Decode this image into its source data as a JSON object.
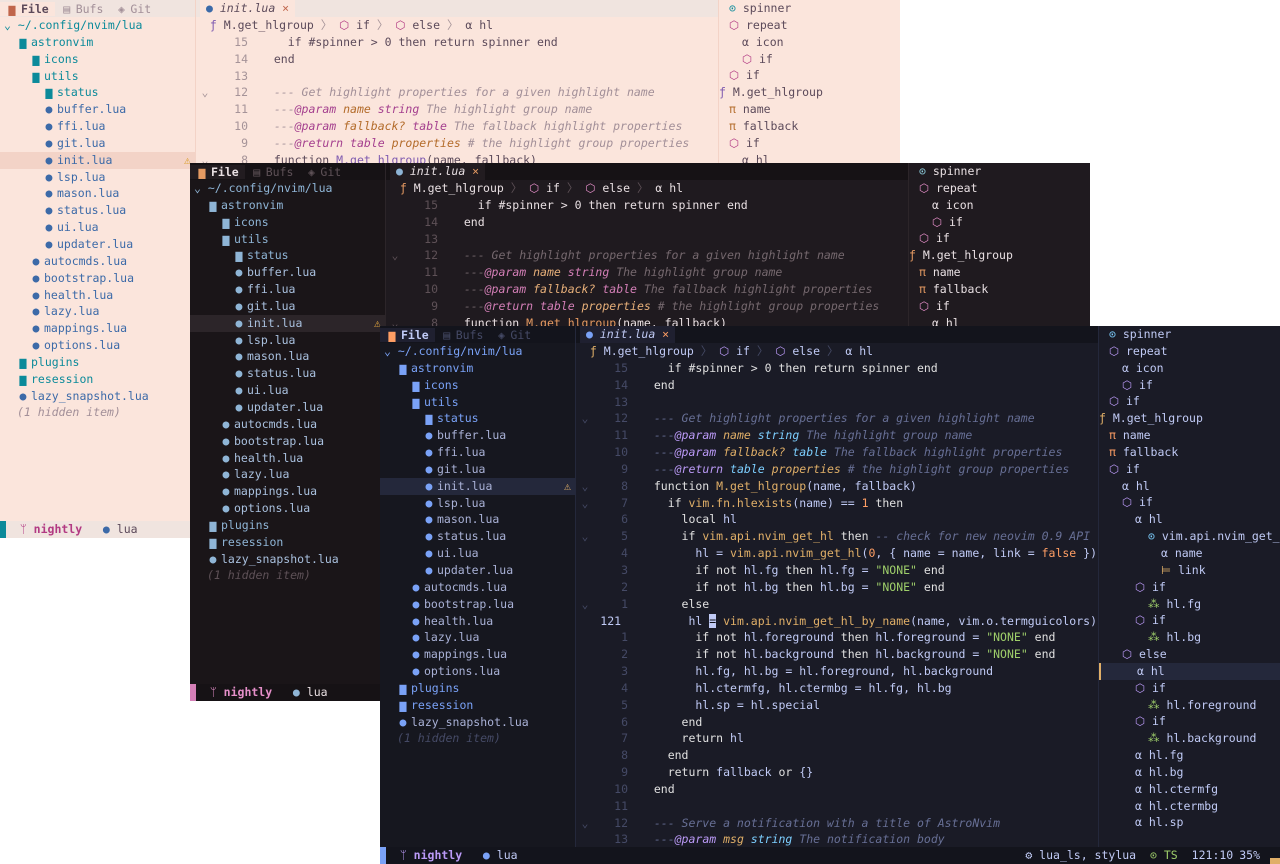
{
  "explorer": {
    "tabs": [
      "File",
      "Bufs",
      "Git"
    ],
    "root": "~/.config/nvim/lua",
    "items": [
      {
        "label": "astronvim",
        "depth": 1,
        "kind": "folder"
      },
      {
        "label": "icons",
        "depth": 2,
        "kind": "folder"
      },
      {
        "label": "utils",
        "depth": 2,
        "kind": "folder"
      },
      {
        "label": "status",
        "depth": 3,
        "kind": "folder"
      },
      {
        "label": "buffer.lua",
        "depth": 3,
        "kind": "file"
      },
      {
        "label": "ffi.lua",
        "depth": 3,
        "kind": "file"
      },
      {
        "label": "git.lua",
        "depth": 3,
        "kind": "file"
      },
      {
        "label": "init.lua",
        "depth": 3,
        "kind": "file",
        "selected": true,
        "warning": true
      },
      {
        "label": "lsp.lua",
        "depth": 3,
        "kind": "file"
      },
      {
        "label": "mason.lua",
        "depth": 3,
        "kind": "file"
      },
      {
        "label": "status.lua",
        "depth": 3,
        "kind": "file"
      },
      {
        "label": "ui.lua",
        "depth": 3,
        "kind": "file"
      },
      {
        "label": "updater.lua",
        "depth": 3,
        "kind": "file"
      },
      {
        "label": "autocmds.lua",
        "depth": 2,
        "kind": "file"
      },
      {
        "label": "bootstrap.lua",
        "depth": 2,
        "kind": "file"
      },
      {
        "label": "health.lua",
        "depth": 2,
        "kind": "file"
      },
      {
        "label": "lazy.lua",
        "depth": 2,
        "kind": "file"
      },
      {
        "label": "mappings.lua",
        "depth": 2,
        "kind": "file"
      },
      {
        "label": "options.lua",
        "depth": 2,
        "kind": "file"
      },
      {
        "label": "plugins",
        "depth": 1,
        "kind": "folder"
      },
      {
        "label": "resession",
        "depth": 1,
        "kind": "folder"
      },
      {
        "label": "lazy_snapshot.lua",
        "depth": 1,
        "kind": "file"
      },
      {
        "label": "(1 hidden item)",
        "depth": 1,
        "kind": "hidden"
      }
    ]
  },
  "buffer_tab": {
    "label": "init.lua",
    "close": "×"
  },
  "breadcrumb": [
    {
      "icon": "ƒ",
      "label": "M.get_hlgroup"
    },
    {
      "icon": "⬡",
      "label": "if"
    },
    {
      "icon": "⬡",
      "label": "else"
    },
    {
      "icon": "α",
      "label": "hl"
    }
  ],
  "code": [
    {
      "n": "15",
      "f": "",
      "t": [
        [
          "    if #spinner > 0 then return spinner end",
          "kw"
        ]
      ]
    },
    {
      "n": "14",
      "f": "",
      "t": [
        [
          "  end",
          "kw"
        ]
      ]
    },
    {
      "n": "13",
      "f": "",
      "t": []
    },
    {
      "n": "12",
      "f": "⌄",
      "t": [
        [
          "  --- Get highlight properties for a given highlight name",
          "cm"
        ]
      ]
    },
    {
      "n": "11",
      "f": "",
      "t": [
        [
          "  ---",
          "cm"
        ],
        [
          "@param",
          "tg"
        ],
        [
          " name ",
          "pm"
        ],
        [
          "string",
          "ty"
        ],
        [
          " The highlight group name",
          "cm"
        ]
      ]
    },
    {
      "n": "10",
      "f": "",
      "t": [
        [
          "  ---",
          "cm"
        ],
        [
          "@param",
          "tg"
        ],
        [
          " fallback? ",
          "pm"
        ],
        [
          "table",
          "ty"
        ],
        [
          " The fallback highlight properties",
          "cm"
        ]
      ]
    },
    {
      "n": "9",
      "f": "",
      "t": [
        [
          "  ---",
          "cm"
        ],
        [
          "@return",
          "tg"
        ],
        [
          " table ",
          "ty"
        ],
        [
          "properties",
          "pm"
        ],
        [
          " # the highlight group properties",
          "cm"
        ]
      ]
    },
    {
      "n": "8",
      "f": "⌄",
      "t": [
        [
          "  function ",
          "kw"
        ],
        [
          "M.get_hlgroup",
          "fn"
        ],
        [
          "(name, fallback)",
          "tx"
        ]
      ]
    },
    {
      "n": "7",
      "f": "⌄",
      "t": [
        [
          "    if ",
          "kw"
        ],
        [
          "vim.fn.hlexists",
          "fn"
        ],
        [
          "(name) == ",
          "tx"
        ],
        [
          "1",
          "nm"
        ],
        [
          " then",
          "kw"
        ]
      ]
    },
    {
      "n": "6",
      "f": "",
      "t": [
        [
          "      local ",
          "kw"
        ],
        [
          "hl",
          "tx"
        ]
      ]
    },
    {
      "n": "5",
      "f": "⌄",
      "t": [
        [
          "      if ",
          "kw"
        ],
        [
          "vim.api.nvim_get_hl",
          "fn"
        ],
        [
          " then ",
          "kw"
        ],
        [
          "-- check for new neovim 0.9 API",
          "cm"
        ]
      ]
    },
    {
      "n": "4",
      "f": "",
      "t": [
        [
          "        hl = ",
          "tx"
        ],
        [
          "vim.api.nvim_get_hl",
          "fn"
        ],
        [
          "(",
          "tx"
        ],
        [
          "0",
          "nm"
        ],
        [
          ", { name = name, link = ",
          "tx"
        ],
        [
          "false",
          "nm"
        ],
        [
          " })",
          "tx"
        ]
      ]
    },
    {
      "n": "3",
      "f": "",
      "t": [
        [
          "        if not ",
          "kw"
        ],
        [
          "hl.fg",
          "tx"
        ],
        [
          " then ",
          "kw"
        ],
        [
          "hl.fg = ",
          "tx"
        ],
        [
          "\"NONE\"",
          "st"
        ],
        [
          " end",
          "kw"
        ]
      ]
    },
    {
      "n": "2",
      "f": "",
      "t": [
        [
          "        if not ",
          "kw"
        ],
        [
          "hl.bg",
          "tx"
        ],
        [
          " then ",
          "kw"
        ],
        [
          "hl.bg = ",
          "tx"
        ],
        [
          "\"NONE\"",
          "st"
        ],
        [
          " end",
          "kw"
        ]
      ]
    },
    {
      "n": "1",
      "f": "⌄",
      "t": [
        [
          "      else",
          "kw"
        ]
      ]
    },
    {
      "n": "121",
      "f": "",
      "cur": true,
      "t": [
        [
          "        hl ",
          "tx"
        ],
        [
          "=",
          "cu"
        ],
        [
          " vim.api.nvim_get_hl_by_name",
          "fn"
        ],
        [
          "(name, vim.o.termguicolors)",
          "tx"
        ]
      ]
    },
    {
      "n": "1",
      "f": "",
      "t": [
        [
          "        if not ",
          "kw"
        ],
        [
          "hl.foreground",
          "tx"
        ],
        [
          " then ",
          "kw"
        ],
        [
          "hl.foreground = ",
          "tx"
        ],
        [
          "\"NONE\"",
          "st"
        ],
        [
          " end",
          "kw"
        ]
      ]
    },
    {
      "n": "2",
      "f": "",
      "t": [
        [
          "        if not ",
          "kw"
        ],
        [
          "hl.background",
          "tx"
        ],
        [
          " then ",
          "kw"
        ],
        [
          "hl.background = ",
          "tx"
        ],
        [
          "\"NONE\"",
          "st"
        ],
        [
          " end",
          "kw"
        ]
      ]
    },
    {
      "n": "3",
      "f": "",
      "t": [
        [
          "        hl.fg, hl.bg = hl.foreground, hl.background",
          "tx"
        ]
      ]
    },
    {
      "n": "4",
      "f": "",
      "t": [
        [
          "        hl.ctermfg, hl.ctermbg = hl.fg, hl.bg",
          "tx"
        ]
      ]
    },
    {
      "n": "5",
      "f": "",
      "t": [
        [
          "        hl.sp = hl.special",
          "tx"
        ]
      ]
    },
    {
      "n": "6",
      "f": "",
      "t": [
        [
          "      end",
          "kw"
        ]
      ]
    },
    {
      "n": "7",
      "f": "",
      "t": [
        [
          "      return ",
          "kw"
        ],
        [
          "hl",
          "tx"
        ]
      ]
    },
    {
      "n": "8",
      "f": "",
      "t": [
        [
          "    end",
          "kw"
        ]
      ]
    },
    {
      "n": "9",
      "f": "",
      "t": [
        [
          "    return ",
          "kw"
        ],
        [
          "fallback",
          "tx"
        ],
        [
          " or ",
          "kw"
        ],
        [
          "{}",
          "tx"
        ]
      ]
    },
    {
      "n": "10",
      "f": "",
      "t": [
        [
          "  end",
          "kw"
        ]
      ]
    },
    {
      "n": "11",
      "f": "",
      "t": []
    },
    {
      "n": "12",
      "f": "⌄",
      "t": [
        [
          "  --- Serve a notification with a title of AstroNvim",
          "cm"
        ]
      ]
    },
    {
      "n": "13",
      "f": "",
      "t": [
        [
          "  ---",
          "cm"
        ],
        [
          "@param",
          "tg"
        ],
        [
          " msg ",
          "pm"
        ],
        [
          "string",
          "ty"
        ],
        [
          " The notification body",
          "cm"
        ]
      ]
    }
  ],
  "outline": [
    {
      "d": 0,
      "i": "⊙",
      "c": "sp",
      "l": "spinner"
    },
    {
      "d": 0,
      "i": "⬡",
      "c": "cb",
      "l": "repeat"
    },
    {
      "d": 1,
      "i": "α",
      "c": "vr",
      "l": "icon"
    },
    {
      "d": 1,
      "i": "⬡",
      "c": "cb",
      "l": "if"
    },
    {
      "d": 0,
      "i": "⬡",
      "c": "cb",
      "l": "if"
    },
    {
      "d": -1,
      "i": "ƒ",
      "c": "fn",
      "l": "M.get_hlgroup"
    },
    {
      "d": 0,
      "i": "π",
      "c": "pa",
      "l": "name"
    },
    {
      "d": 0,
      "i": "π",
      "c": "pa",
      "l": "fallback"
    },
    {
      "d": 0,
      "i": "⬡",
      "c": "cb",
      "l": "if"
    },
    {
      "d": 1,
      "i": "α",
      "c": "vr",
      "l": "hl"
    },
    {
      "d": 1,
      "i": "⬡",
      "c": "cb",
      "l": "if"
    },
    {
      "d": 2,
      "i": "α",
      "c": "vr",
      "l": "hl"
    },
    {
      "d": 3,
      "i": "⊙",
      "c": "sp",
      "l": "vim.api.nvim_get_hl"
    },
    {
      "d": 4,
      "i": "α",
      "c": "vr",
      "l": "name"
    },
    {
      "d": 4,
      "i": "⊨",
      "c": "bo",
      "l": "link"
    },
    {
      "d": 2,
      "i": "⬡",
      "c": "cb",
      "l": "if"
    },
    {
      "d": 3,
      "i": "⁂",
      "c": "fd",
      "l": "hl.fg"
    },
    {
      "d": 2,
      "i": "⬡",
      "c": "cb",
      "l": "if"
    },
    {
      "d": 3,
      "i": "⁂",
      "c": "fd",
      "l": "hl.bg"
    },
    {
      "d": 1,
      "i": "⬡",
      "c": "cb",
      "l": "else",
      "sel": true
    },
    {
      "d": 2,
      "i": "α",
      "c": "vr",
      "l": "hl",
      "cur": true
    },
    {
      "d": 2,
      "i": "⬡",
      "c": "cb",
      "l": "if"
    },
    {
      "d": 3,
      "i": "⁂",
      "c": "fd",
      "l": "hl.foreground"
    },
    {
      "d": 2,
      "i": "⬡",
      "c": "cb",
      "l": "if"
    },
    {
      "d": 3,
      "i": "⁂",
      "c": "fd",
      "l": "hl.background"
    },
    {
      "d": 2,
      "i": "α",
      "c": "vr",
      "l": "hl.fg"
    },
    {
      "d": 2,
      "i": "α",
      "c": "vr",
      "l": "hl.bg"
    },
    {
      "d": 2,
      "i": "α",
      "c": "vr",
      "l": "hl.ctermfg"
    },
    {
      "d": 2,
      "i": "α",
      "c": "vr",
      "l": "hl.ctermbg"
    },
    {
      "d": 2,
      "i": "α",
      "c": "vr",
      "l": "hl.sp"
    }
  ],
  "status": {
    "mode": "nightly",
    "filetype": "lua",
    "lsp": "lua_ls, stylua",
    "ts": "TS",
    "position": "121:10",
    "percent": "35%"
  },
  "themes": [
    {
      "name": "light",
      "colors": {
        "bg": "#fbe5dc",
        "side": "#fbe5dc",
        "sel": "#f3d3c7",
        "tabbar": "#f0e4df",
        "tabact": "#fbe5dc",
        "tx": "#5c4a5a",
        "kw": "#5c4a5a",
        "fn": "#7f5bb0",
        "st": "#3c8a6a",
        "nm": "#c0654b",
        "cm": "#a28f98",
        "tg": "#a43f8e",
        "pm": "#b36b2a",
        "ty": "#a43f8e",
        "cu": "#5c4a5a",
        "ln": "#a59398",
        "lncur": "#5c4a5a",
        "folder": "#0b8a9a",
        "file": "#3c6aa8",
        "icon": "#3c6aa8",
        "sb": "#f0e4df",
        "sbtx": "#5c4a5a",
        "accent": "#0b8a9a",
        "sp": "#0b8a9a",
        "cb": "#b23a83",
        "vr": "#5c4a5a",
        "pa": "#b36b2a",
        "bo": "#b36b2a",
        "fd": "#3c8a6a",
        "hid": "#a28f98",
        "warn": "#d99a1c",
        "crumb": "#5c4a5a"
      }
    },
    {
      "name": "mid",
      "colors": {
        "bg": "#1f1a1f",
        "side": "#1a1518",
        "sel": "#2c2529",
        "tabbar": "#161215",
        "tabact": "#221c20",
        "tx": "#e8dfe2",
        "kw": "#e8dfe2",
        "fn": "#e59a62",
        "st": "#9bc28a",
        "nm": "#e59a62",
        "cm": "#75686e",
        "tg": "#d47fb7",
        "pm": "#e8b07a",
        "ty": "#d47fb7",
        "cu": "#e8dfe2",
        "ln": "#5e5157",
        "lncur": "#e8dfe2",
        "folder": "#8fb5d6",
        "file": "#a9c0de",
        "icon": "#8fb5d6",
        "sb": "#161215",
        "sbtx": "#e8dfe2",
        "accent": "#d47fb7",
        "sp": "#8fd0e0",
        "cb": "#e58fc9",
        "vr": "#e8dfe2",
        "pa": "#e59a62",
        "bo": "#e59a62",
        "fd": "#9bc28a",
        "hid": "#5e5157",
        "warn": "#f0b040",
        "crumb": "#e8dfe2"
      }
    },
    {
      "name": "dark",
      "colors": {
        "bg": "#1a1b26",
        "side": "#16171f",
        "sel": "#24283b",
        "tabbar": "#13141c",
        "tabact": "#1f2030",
        "tx": "#c0caf5",
        "kw": "#e0e0e0",
        "fn": "#e0af68",
        "st": "#9ece6a",
        "nm": "#ff9e64",
        "cm": "#676f95",
        "tg": "#bb9af7",
        "pm": "#e0af68",
        "ty": "#7dcfff",
        "cu": "#0d0e14",
        "ln": "#454a66",
        "lncur": "#c0caf5",
        "folder": "#7aa2f7",
        "file": "#a9b1d6",
        "icon": "#7aa2f7",
        "sb": "#13141c",
        "sbtx": "#c0caf5",
        "accent": "#7aa2f7",
        "sp": "#7dcfff",
        "cb": "#bb9af7",
        "vr": "#c0caf5",
        "pa": "#ff9e64",
        "bo": "#e0af68",
        "fd": "#9ece6a",
        "hid": "#454a66",
        "warn": "#e0af68",
        "crumb": "#c0caf5"
      }
    }
  ]
}
